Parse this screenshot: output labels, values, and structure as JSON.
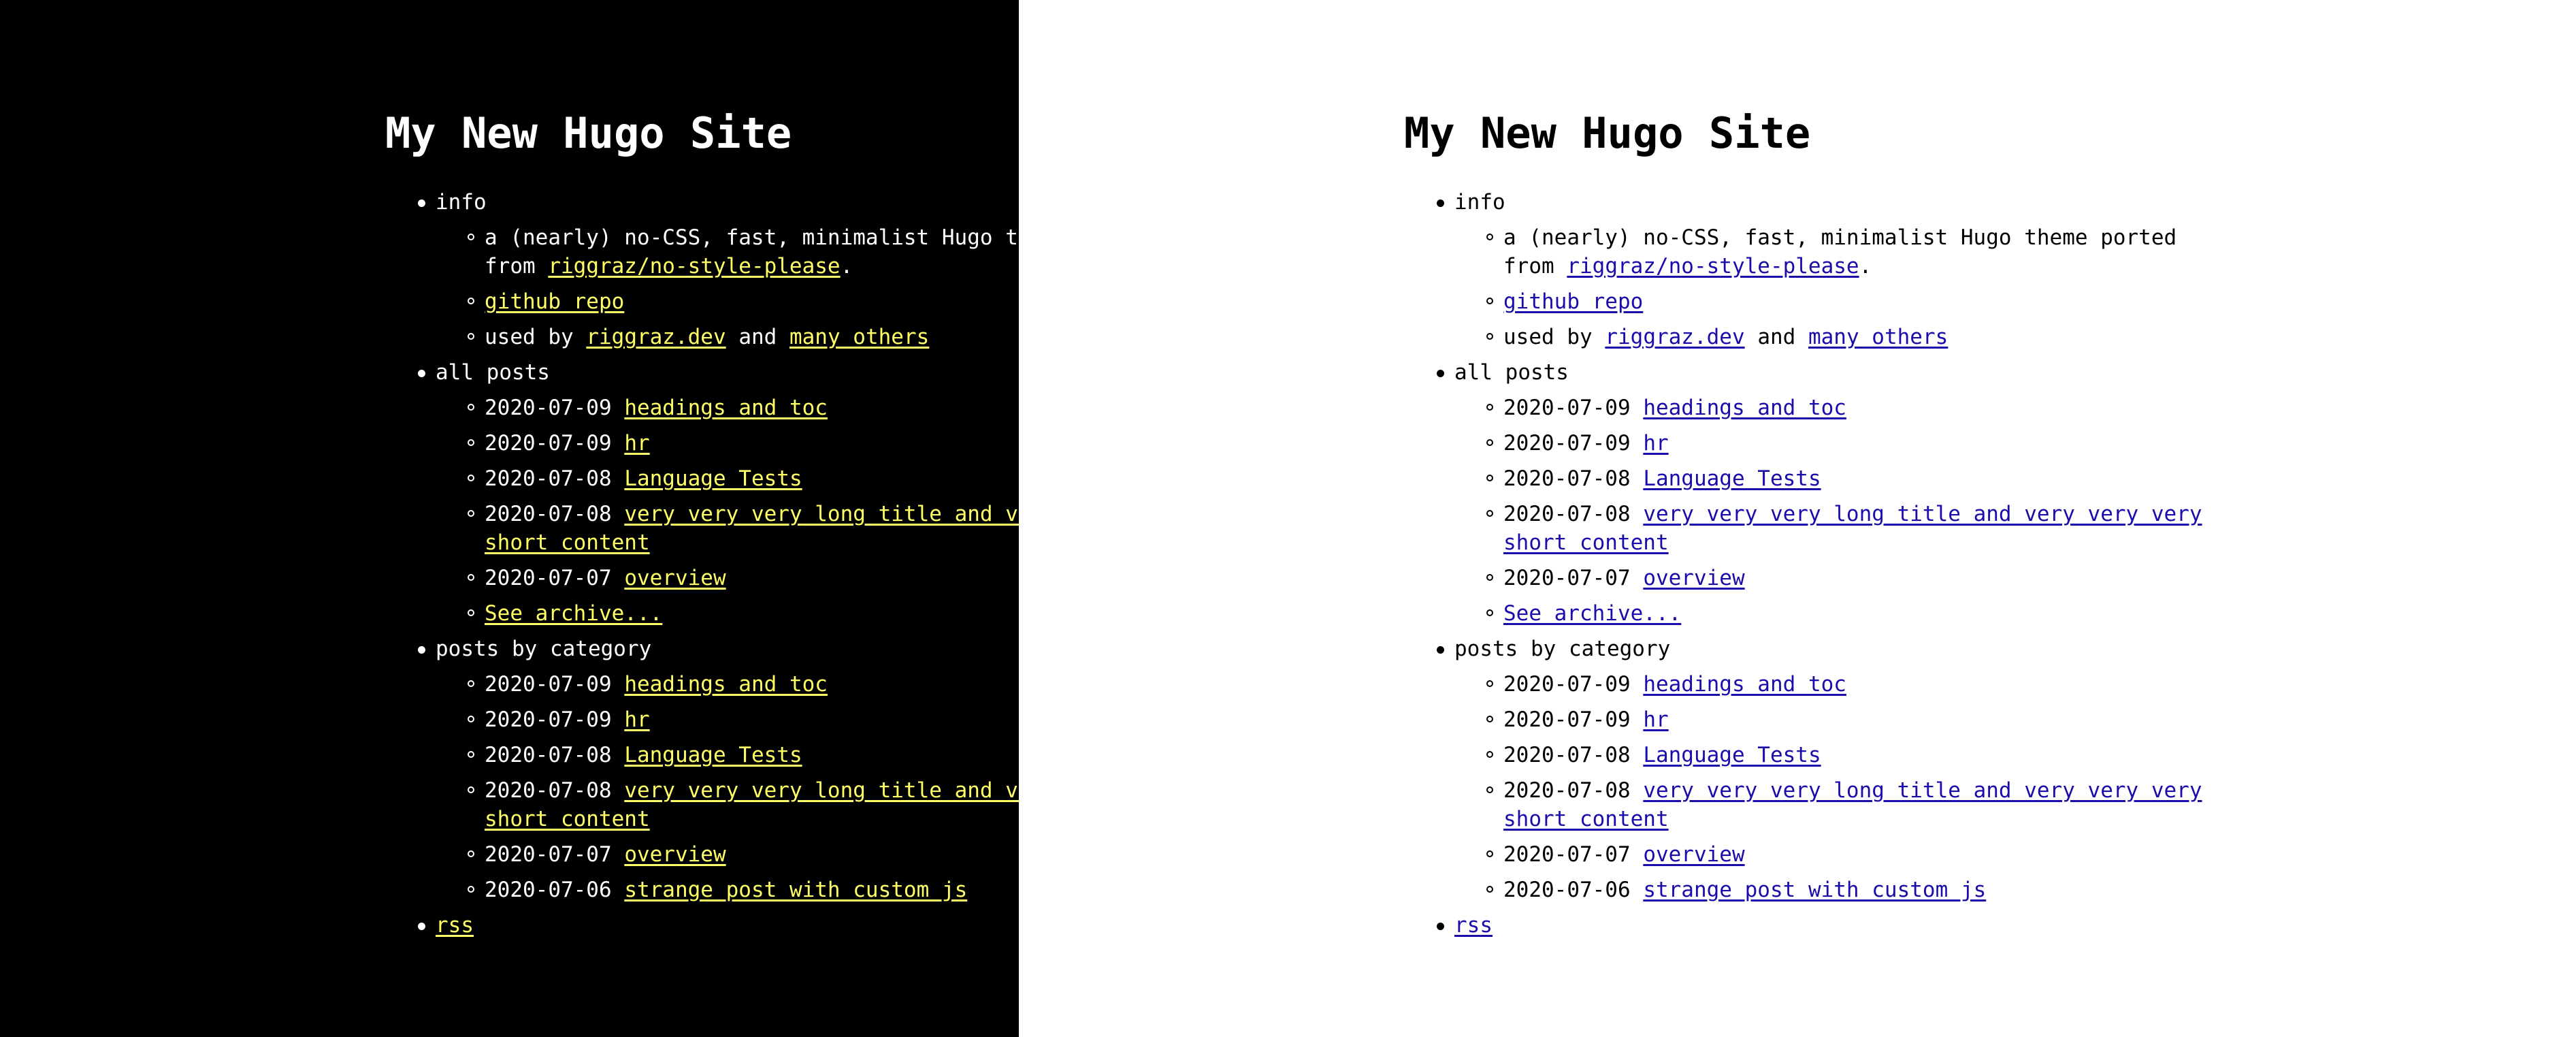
{
  "site": {
    "title": "My New Hugo Site"
  },
  "info": {
    "label": "info",
    "description_prefix": "a (nearly) no-CSS, fast, minimalist Hugo theme ported from",
    "description_link": "riggraz/no-style-please",
    "description_suffix": ".",
    "github_link": "github repo",
    "used_by_prefix": "used by",
    "used_by_link1": "riggraz.dev",
    "used_by_and": "and",
    "used_by_link2": "many others"
  },
  "all_posts": {
    "label": "all posts",
    "items": [
      {
        "date": "2020-07-09",
        "title": "headings and toc"
      },
      {
        "date": "2020-07-09",
        "title": "hr"
      },
      {
        "date": "2020-07-08",
        "title": "Language Tests"
      },
      {
        "date": "2020-07-08",
        "title": "very very very long title and very very very short content"
      },
      {
        "date": "2020-07-07",
        "title": "overview"
      }
    ],
    "archive_link": "See archive..."
  },
  "by_category": {
    "label": "posts by category",
    "items": [
      {
        "date": "2020-07-09",
        "title": "headings and toc"
      },
      {
        "date": "2020-07-09",
        "title": "hr"
      },
      {
        "date": "2020-07-08",
        "title": "Language Tests"
      },
      {
        "date": "2020-07-08",
        "title": "very very very long title and very very very short content"
      },
      {
        "date": "2020-07-07",
        "title": "overview"
      },
      {
        "date": "2020-07-06",
        "title": "strange post with custom js"
      }
    ]
  },
  "rss_link": "rss",
  "colors": {
    "dark_background": "#000000",
    "dark_text": "#ffffff",
    "dark_link": "#ffff66",
    "light_background": "#ffffff",
    "light_text": "#000000",
    "light_link": "#1a0dab"
  }
}
